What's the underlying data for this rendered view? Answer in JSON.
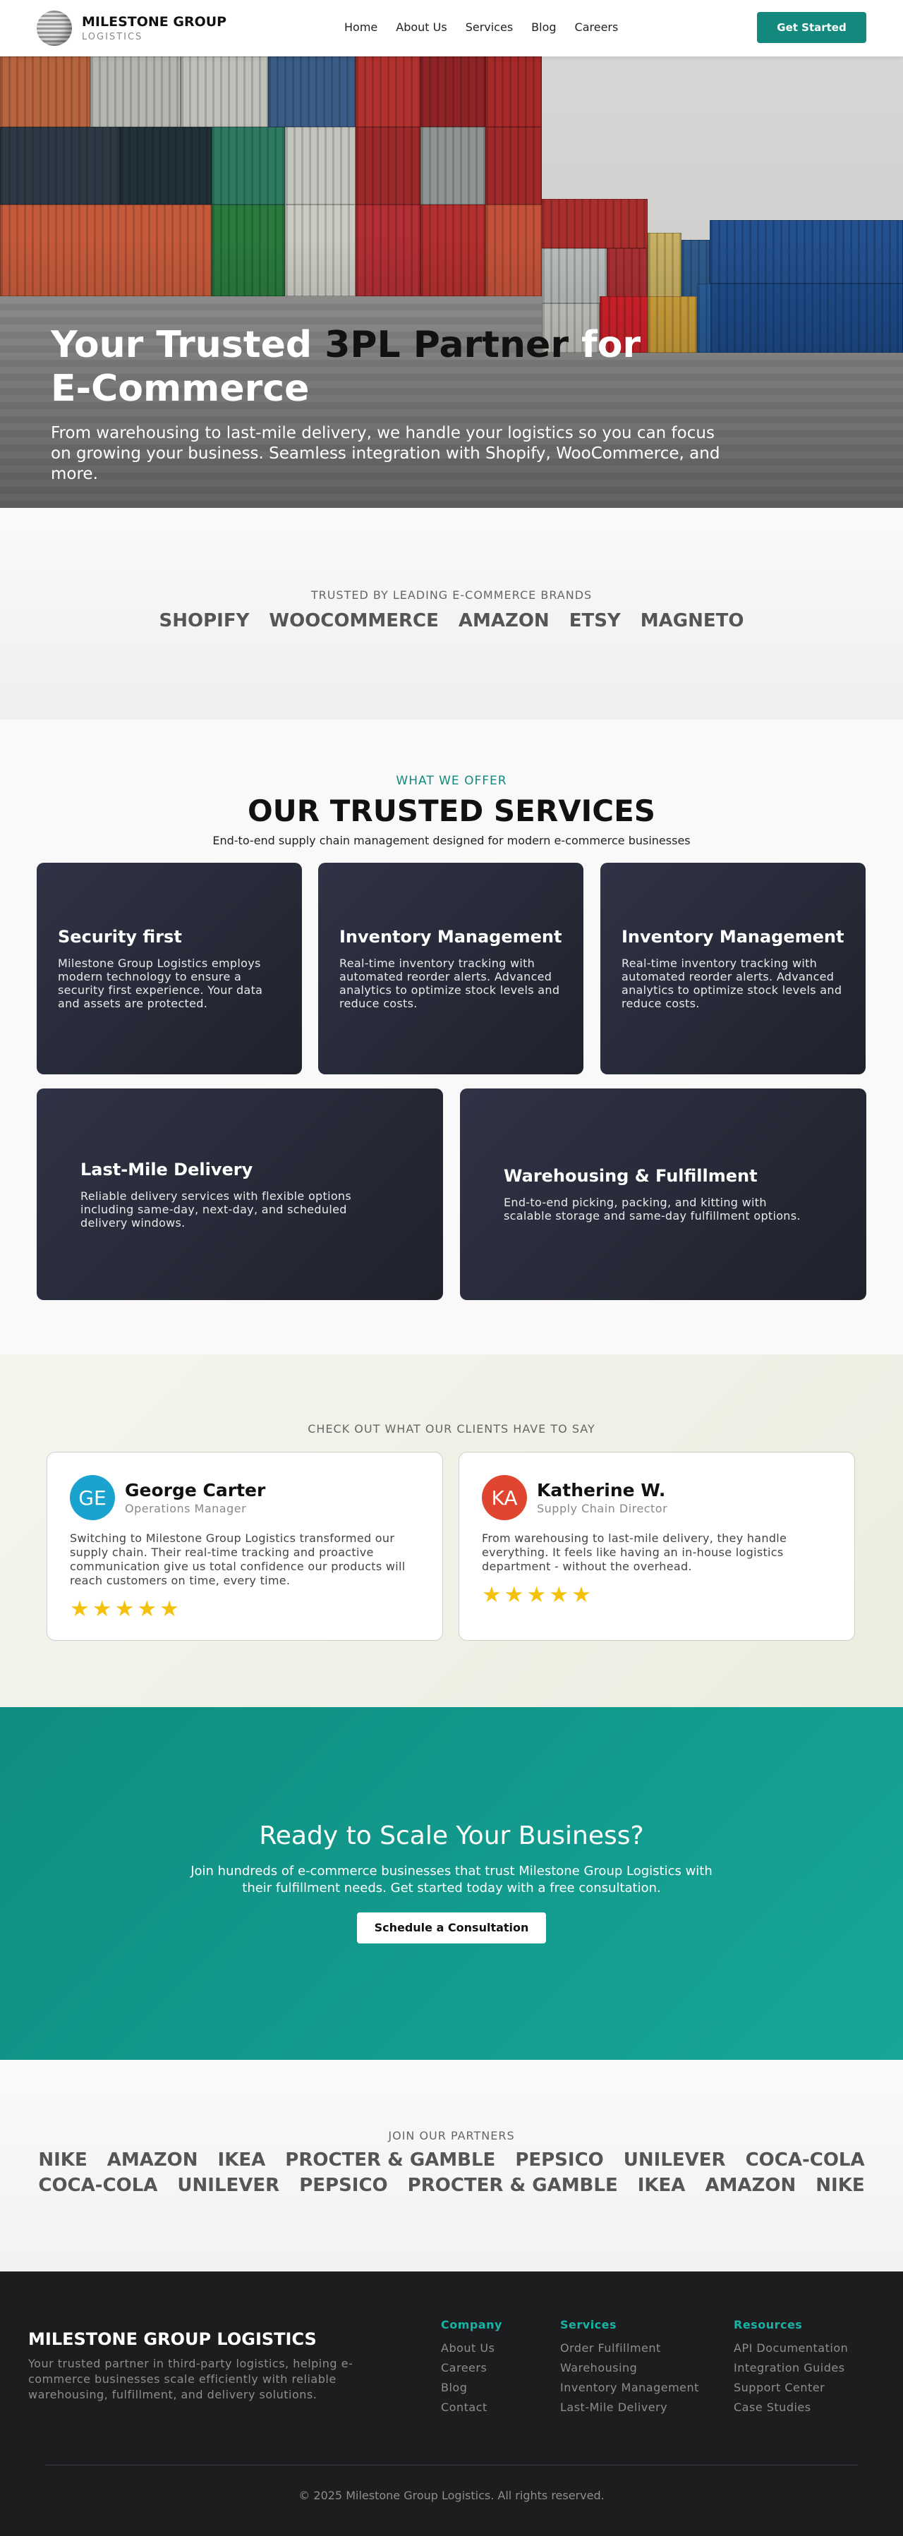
{
  "nav": {
    "brand_name": "MILESTONE GROUP",
    "brand_sub": "LOGISTICS",
    "links": [
      "Home",
      "About Us",
      "Services",
      "Blog",
      "Careers"
    ],
    "cta": "Get Started"
  },
  "hero": {
    "title_part1": "Your Trusted ",
    "title_part2": "3PL Partner",
    "title_part3": " for",
    "title_line2": "E-Commerce",
    "subtitle": "From warehousing to last-mile delivery, we handle your logistics so you can focus on growing your business. Seamless integration with Shopify, WooCommerce, and more."
  },
  "trusted": {
    "kicker": "TRUSTED BY LEADING E-COMMERCE BRANDS",
    "brands": [
      "SHOPIFY",
      "WOOCOMMERCE",
      "AMAZON",
      "ETSY",
      "MAGNETO"
    ]
  },
  "services": {
    "eyebrow": "WHAT WE OFFER",
    "title": "OUR TRUSTED SERVICES",
    "description": "End-to-end supply chain management designed for modern e-commerce businesses",
    "cards": [
      {
        "title": "Security first",
        "desc": "Milestone Group Logistics employs modern technology to ensure a security first experience. Your data and assets are protected."
      },
      {
        "title": "Inventory Management",
        "desc": "Real-time inventory tracking with automated reorder alerts. Advanced analytics to optimize stock levels and reduce costs."
      },
      {
        "title": "Inventory Management",
        "desc": "Real-time inventory tracking with automated reorder alerts. Advanced analytics to optimize stock levels and reduce costs."
      },
      {
        "title": "Last-Mile Delivery",
        "desc": "Reliable delivery services with flexible options including same-day, next-day, and scheduled delivery windows."
      },
      {
        "title": "Warehousing & Fulfillment",
        "desc": "End-to-end picking, packing, and kitting with scalable storage and same-day fulfillment options."
      }
    ]
  },
  "testimonials": {
    "kicker": "CHECK OUT WHAT OUR CLIENTS HAVE TO SAY",
    "items": [
      {
        "initials": "GE",
        "name": "George Carter",
        "role": "Operations Manager",
        "quote": "Switching to Milestone Group Logistics transformed our supply chain. Their real-time tracking and proactive communication give us total confidence our products will reach customers on time, every time.",
        "stars": "★★★★★",
        "rating": 5,
        "avatar_color": "#1aa3cf"
      },
      {
        "initials": "KA",
        "name": "Katherine W.",
        "role": "Supply Chain Director",
        "quote": "From warehousing to last-mile delivery, they handle everything. It feels like having an in-house logistics department - without the overhead.",
        "stars": "★★★★★",
        "rating": 5,
        "avatar_color": "#e0452f"
      }
    ]
  },
  "cta": {
    "title": "Ready to Scale Your Business?",
    "text": "Join hundreds of e-commerce businesses that trust Milestone Group Logistics with their fulfillment needs. Get started today with a free consultation.",
    "button": "Schedule a Consultation"
  },
  "partners": {
    "kicker": "JOIN OUR PARTNERS",
    "row1": [
      "NIKE",
      "AMAZON",
      "IKEA",
      "PROCTER & GAMBLE",
      "PEPSICO",
      "UNILEVER",
      "COCA-COLA"
    ],
    "row2": [
      "COCA-COLA",
      "UNILEVER",
      "PEPSICO",
      "PROCTER & GAMBLE",
      "IKEA",
      "AMAZON",
      "NIKE"
    ]
  },
  "footer": {
    "brand": "MILESTONE GROUP LOGISTICS",
    "description": "Your trusted partner in third-party logistics, helping e-commerce businesses scale efficiently with reliable warehousing, fulfillment, and delivery solutions.",
    "columns": [
      {
        "heading": "Company",
        "links": [
          "About Us",
          "Careers",
          "Blog",
          "Contact"
        ]
      },
      {
        "heading": "Services",
        "links": [
          "Order Fulfillment",
          "Warehousing",
          "Inventory Management",
          "Last-Mile Delivery"
        ]
      },
      {
        "heading": "Resources",
        "links": [
          "API Documentation",
          "Integration Guides",
          "Support Center",
          "Case Studies"
        ]
      }
    ],
    "copyright": "© 2025 Milestone Group Logistics. All rights reserved."
  },
  "colors": {
    "accent": "#13897d",
    "dark_card": "#2a2d3b",
    "footer_bg": "#1d1d20",
    "star": "#f4c20d"
  }
}
